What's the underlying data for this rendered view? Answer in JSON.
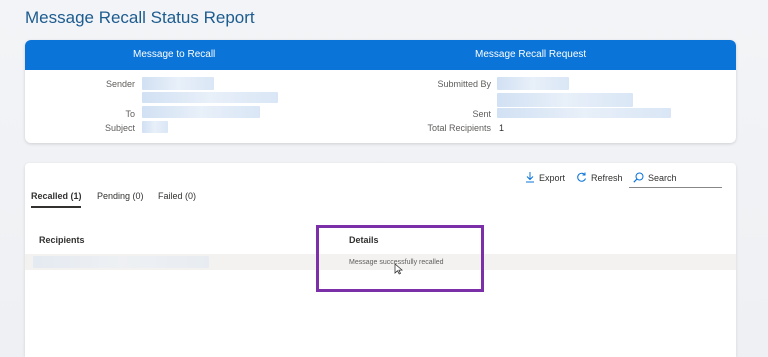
{
  "page": {
    "title": "Message Recall Status Report"
  },
  "summary": {
    "left_header": "Message to Recall",
    "right_header": "Message Recall Request",
    "sender_label": "Sender",
    "to_label": "To",
    "subject_label": "Subject",
    "submitted_by_label": "Submitted By",
    "sent_label": "Sent",
    "total_recipients_label": "Total Recipients",
    "total_recipients_value": "1"
  },
  "toolbar": {
    "export": "Export",
    "refresh": "Refresh",
    "search_placeholder": "Search"
  },
  "tabs": [
    {
      "label": "Recalled (1)",
      "active": true
    },
    {
      "label": "Pending (0)",
      "active": false
    },
    {
      "label": "Failed (0)",
      "active": false
    }
  ],
  "table": {
    "columns": [
      "Recipients",
      "Details"
    ],
    "rows": [
      {
        "recipient": "",
        "details": "Message successfully recalled"
      }
    ]
  },
  "colors": {
    "header_blue": "#0a74d8",
    "title_blue": "#1d5c8f",
    "highlight_purple": "#7b2fa8"
  },
  "icons": [
    "download-icon",
    "refresh-icon",
    "search-icon",
    "mouse-cursor-icon"
  ]
}
